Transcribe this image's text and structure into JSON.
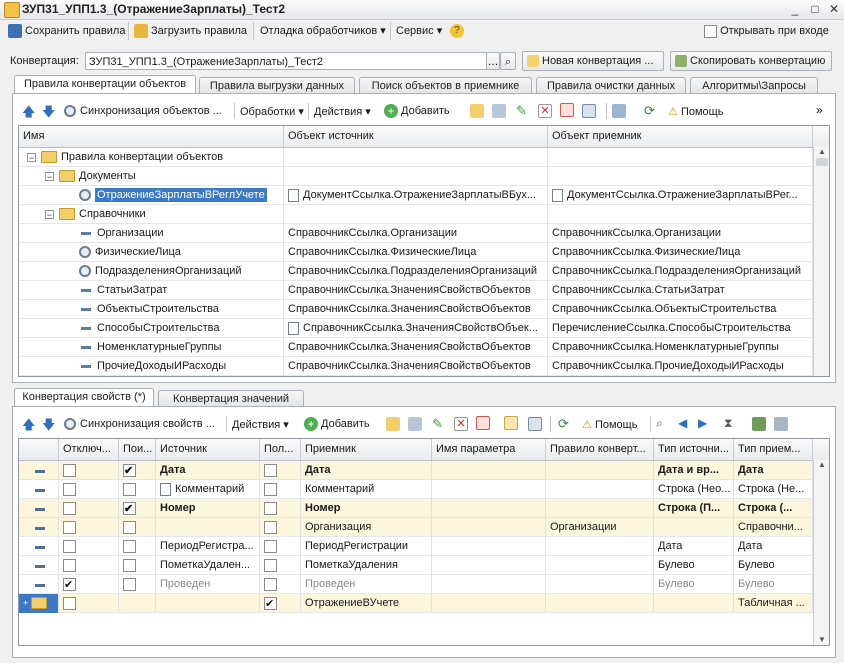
{
  "window": {
    "title": "ЗУП31_УПП1.3_(ОтражениеЗарплаты)_Тест2",
    "controls": [
      "_",
      "□",
      "✕"
    ]
  },
  "toolbar": {
    "save_label": "Сохранить правила",
    "load_label": "Загрузить правила",
    "debug_label": "Отладка обработчиков",
    "service_label": "Сервис",
    "open_on_start_label": "Открывать при входе"
  },
  "conversion": {
    "label": "Конвертация:",
    "value": "ЗУП31_УПП1.3_(ОтражениеЗарплаты)_Тест2",
    "new_label": "Новая конвертация ...",
    "copy_label": "Скопировать конвертацию"
  },
  "top_tabs": [
    "Правила конвертации объектов",
    "Правила выгрузки данных",
    "Поиск объектов в приемнике",
    "Правила очистки данных",
    "Алгоритмы\\Запросы"
  ],
  "rules_toolbar": {
    "sync_label": "Синхронизация объектов ...",
    "handlers_label": "Обработки",
    "actions_label": "Действия",
    "add_label": "Добавить",
    "help_label": "Помощь"
  },
  "rules_grid": {
    "columns": [
      "Имя",
      "Объект источник",
      "Объект приемник"
    ],
    "rows": [
      {
        "name": "Правила конвертации объектов",
        "source": "",
        "target": ""
      },
      {
        "name": "Документы",
        "source": "",
        "target": ""
      },
      {
        "name": "ОтражениеЗарплатыВРеглУчете",
        "source": "ДокументСсылка.ОтражениеЗарплатыВБух...",
        "target": "ДокументСсылка.ОтражениеЗарплатыВРег..."
      },
      {
        "name": "Справочники",
        "source": "",
        "target": ""
      },
      {
        "name": "Организации",
        "source": "СправочникСсылка.Организации",
        "target": "СправочникСсылка.Организации"
      },
      {
        "name": "ФизическиеЛица",
        "source": "СправочникСсылка.ФизическиеЛица",
        "target": "СправочникСсылка.ФизическиеЛица"
      },
      {
        "name": "ПодразделенияОрганизаций",
        "source": "СправочникСсылка.ПодразделенияОрганизаций",
        "target": "СправочникСсылка.ПодразделенияОрганизаций"
      },
      {
        "name": "СтатьиЗатрат",
        "source": "СправочникСсылка.ЗначенияСвойствОбъектов",
        "target": "СправочникСсылка.СтатьиЗатрат"
      },
      {
        "name": "ОбъектыСтроительства",
        "source": "СправочникСсылка.ЗначенияСвойствОбъектов",
        "target": "СправочникСсылка.ОбъектыСтроительства"
      },
      {
        "name": "СпособыСтроительства",
        "source": "СправочникСсылка.ЗначенияСвойствОбъек...",
        "target": "ПеречислениеСсылка.СпособыСтроительства"
      },
      {
        "name": "НоменклатурныеГруппы",
        "source": "СправочникСсылка.ЗначенияСвойствОбъектов",
        "target": "СправочникСсылка.НоменклатурныеГруппы"
      },
      {
        "name": "ПрочиеДоходыИРасходы",
        "source": "СправочникСсылка.ЗначенияСвойствОбъектов",
        "target": "СправочникСсылка.ПрочиеДоходыИРасходы"
      }
    ]
  },
  "bottom_tabs": [
    "Конвертация свойств (*)",
    "Конвертация значений"
  ],
  "props_toolbar": {
    "sync_label": "Синхронизация свойств ...",
    "actions_label": "Действия",
    "add_label": "Добавить",
    "help_label": "Помощь"
  },
  "props_grid": {
    "columns": [
      "Отключ...",
      "Пои...",
      "Источник",
      "Пол...",
      "Приемник",
      "Имя параметра",
      "Правило конверт...",
      "Тип источни...",
      "Тип прием..."
    ],
    "rows": [
      {
        "source": "Дата",
        "target": "Дата",
        "param": "",
        "rule": "",
        "stype": "Дата и вр...",
        "ttype": "Дата"
      },
      {
        "source": "Комментарий",
        "target": "Комментарий",
        "param": "",
        "rule": "",
        "stype": "Строка (Нео...",
        "ttype": "Строка (Не..."
      },
      {
        "source": "Номер",
        "target": "Номер",
        "param": "",
        "rule": "",
        "stype": "Строка (П...",
        "ttype": "Строка (..."
      },
      {
        "source": "",
        "target": "Организация",
        "param": "",
        "rule": "Организации",
        "stype": "",
        "ttype": "Справочни..."
      },
      {
        "source": "ПериодРегистра...",
        "target": "ПериодРегистрации",
        "param": "",
        "rule": "",
        "stype": "Дата",
        "ttype": "Дата"
      },
      {
        "source": "ПометкаУдален...",
        "target": "ПометкаУдаления",
        "param": "",
        "rule": "",
        "stype": "Булево",
        "ttype": "Булево"
      },
      {
        "source": "Проведен",
        "target": "Проведен",
        "param": "",
        "rule": "",
        "stype": "Булево",
        "ttype": "Булево"
      },
      {
        "source": "",
        "target": "ОтражениеВУчете",
        "param": "",
        "rule": "",
        "stype": "",
        "ttype": "Табличная ..."
      }
    ]
  },
  "colors": {
    "selection": "#3c78c8",
    "grid_header": "#eceef1",
    "row_highlight": "#fbf6dc"
  }
}
